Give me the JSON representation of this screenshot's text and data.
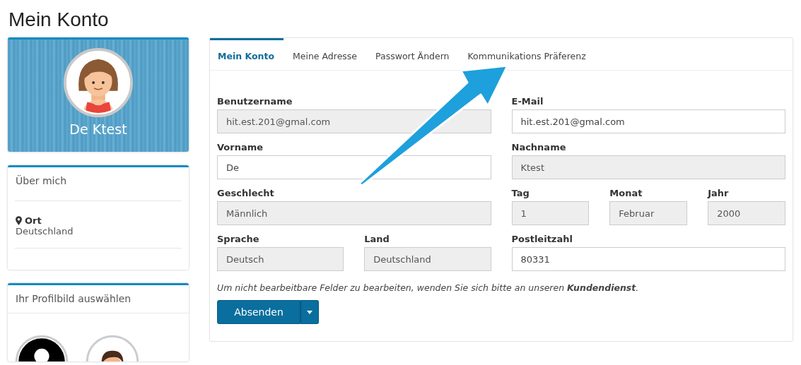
{
  "page_title": "Mein Konto",
  "profile": {
    "name": "De Ktest"
  },
  "about": {
    "title": "Über mich",
    "location_label": "Ort",
    "location": "Deutschland"
  },
  "picture_picker": {
    "title": "Ihr Profilbild auswählen",
    "avatars": [
      {
        "kind": "silhouette"
      },
      {
        "kind": "man"
      }
    ]
  },
  "tabs": [
    {
      "label": "Mein Konto",
      "selected": true
    },
    {
      "label": "Meine Adresse",
      "selected": false
    },
    {
      "label": "Passwort Ändern",
      "selected": false
    },
    {
      "label": "Kommunikations Präferenz",
      "selected": false
    }
  ],
  "form": {
    "rows": [
      [
        [
          {
            "label": "Benutzername",
            "value": "hit.est.201@gmal.com",
            "disabled": true
          }
        ],
        [
          {
            "label": "E-Mail",
            "value": "hit.est.201@gmal.com",
            "disabled": false
          }
        ]
      ],
      [
        [
          {
            "label": "Vorname",
            "value": "De",
            "disabled": false
          }
        ],
        [
          {
            "label": "Nachname",
            "value": "Ktest",
            "disabled": true
          }
        ]
      ],
      [
        [
          {
            "label": "Geschlecht",
            "value": "Männlich",
            "disabled": true
          }
        ],
        [
          {
            "label": "Tag",
            "value": "1",
            "disabled": true
          },
          {
            "label": "Monat",
            "value": "Februar",
            "disabled": true
          },
          {
            "label": "Jahr",
            "value": "2000",
            "disabled": true
          }
        ]
      ],
      [
        [
          {
            "label": "Sprache",
            "value": "Deutsch",
            "disabled": true
          },
          {
            "label": "Land",
            "value": "Deutschland",
            "disabled": true
          }
        ],
        [
          {
            "label": "Postleitzahl",
            "value": "80331",
            "disabled": false
          }
        ]
      ]
    ]
  },
  "note": "Um nicht bearbeitbare Felder zu bearbeiten, wenden Sie sich bitte an unseren **Kundendienst**.",
  "submit": {
    "label": "Absenden"
  }
}
